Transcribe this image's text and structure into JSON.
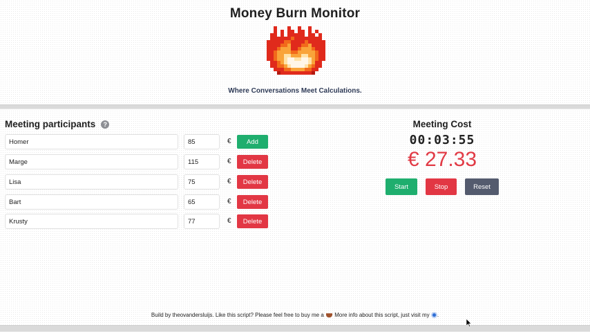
{
  "header": {
    "title": "Money Burn Monitor",
    "tagline": "Where Conversations Meet Calculations.",
    "logo_icon": "pixel-fire-icon"
  },
  "participants": {
    "title": "Meeting participants",
    "help_icon": "question-mark-icon",
    "currency": "€",
    "rows": [
      {
        "name": "Homer",
        "rate": "85",
        "action": "Add"
      },
      {
        "name": "Marge",
        "rate": "115",
        "action": "Delete"
      },
      {
        "name": "Lisa",
        "rate": "75",
        "action": "Delete"
      },
      {
        "name": "Bart",
        "rate": "65",
        "action": "Delete"
      },
      {
        "name": "Krusty",
        "rate": "77",
        "action": "Delete"
      }
    ]
  },
  "cost": {
    "title": "Meeting Cost",
    "timer": "00:03:55",
    "amount": "€ 27.33",
    "start_label": "Start",
    "stop_label": "Stop",
    "reset_label": "Reset"
  },
  "footer": {
    "text_before": "Build by theovandersluijs. Like this script? Please feel free to buy me a",
    "text_middle": "More info about this script, just visit my",
    "text_after": "."
  },
  "colors": {
    "green": "#1fae6e",
    "red": "#e23744",
    "slate": "#545b6e",
    "amount": "#e13a45"
  }
}
